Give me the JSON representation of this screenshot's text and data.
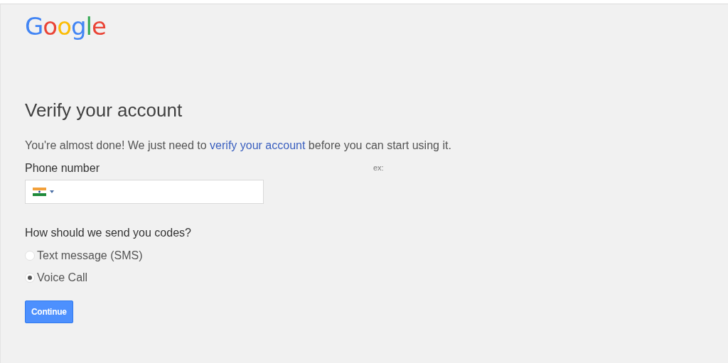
{
  "logo": "Google",
  "heading": "Verify your account",
  "intro": {
    "before": "You're almost done! We just need to ",
    "link": "verify your account",
    "after": " before you can start using it."
  },
  "phone": {
    "label": "Phone number",
    "hint": "ex:",
    "country_dropdown": {
      "expanded": false
    }
  },
  "delivery": {
    "question": "How should we send you codes?",
    "options": [
      {
        "label": "Text message (SMS)",
        "selected": false
      },
      {
        "label": "Voice Call",
        "selected": true
      }
    ]
  },
  "buttons": [
    "Continue"
  ]
}
